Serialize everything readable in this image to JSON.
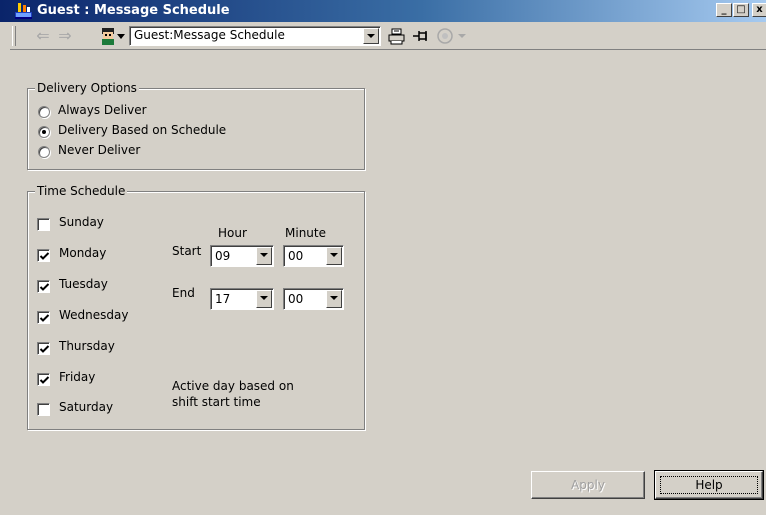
{
  "window": {
    "title": "Guest : Message Schedule",
    "min_glyph": "_",
    "max_glyph": "□",
    "close_glyph": "x"
  },
  "toolbar": {
    "back_glyph": "⇐",
    "forward_glyph": "⇒",
    "location_value": "Guest:Message Schedule"
  },
  "delivery": {
    "legend": "Delivery Options",
    "options": [
      {
        "label": "Always Deliver",
        "selected": false
      },
      {
        "label": "Delivery Based on Schedule",
        "selected": true
      },
      {
        "label": "Never Deliver",
        "selected": false
      }
    ]
  },
  "schedule": {
    "legend": "Time Schedule",
    "days": [
      {
        "label": "Sunday",
        "checked": false
      },
      {
        "label": "Monday",
        "checked": true
      },
      {
        "label": "Tuesday",
        "checked": true
      },
      {
        "label": "Wednesday",
        "checked": true
      },
      {
        "label": "Thursday",
        "checked": true
      },
      {
        "label": "Friday",
        "checked": true
      },
      {
        "label": "Saturday",
        "checked": false
      }
    ],
    "hour_header": "Hour",
    "minute_header": "Minute",
    "start_label": "Start",
    "end_label": "End",
    "start_hour": "09",
    "start_minute": "00",
    "end_hour": "17",
    "end_minute": "00",
    "note_line1": "Active day based on",
    "note_line2": "shift start time"
  },
  "buttons": {
    "apply": "Apply",
    "help": "Help"
  }
}
